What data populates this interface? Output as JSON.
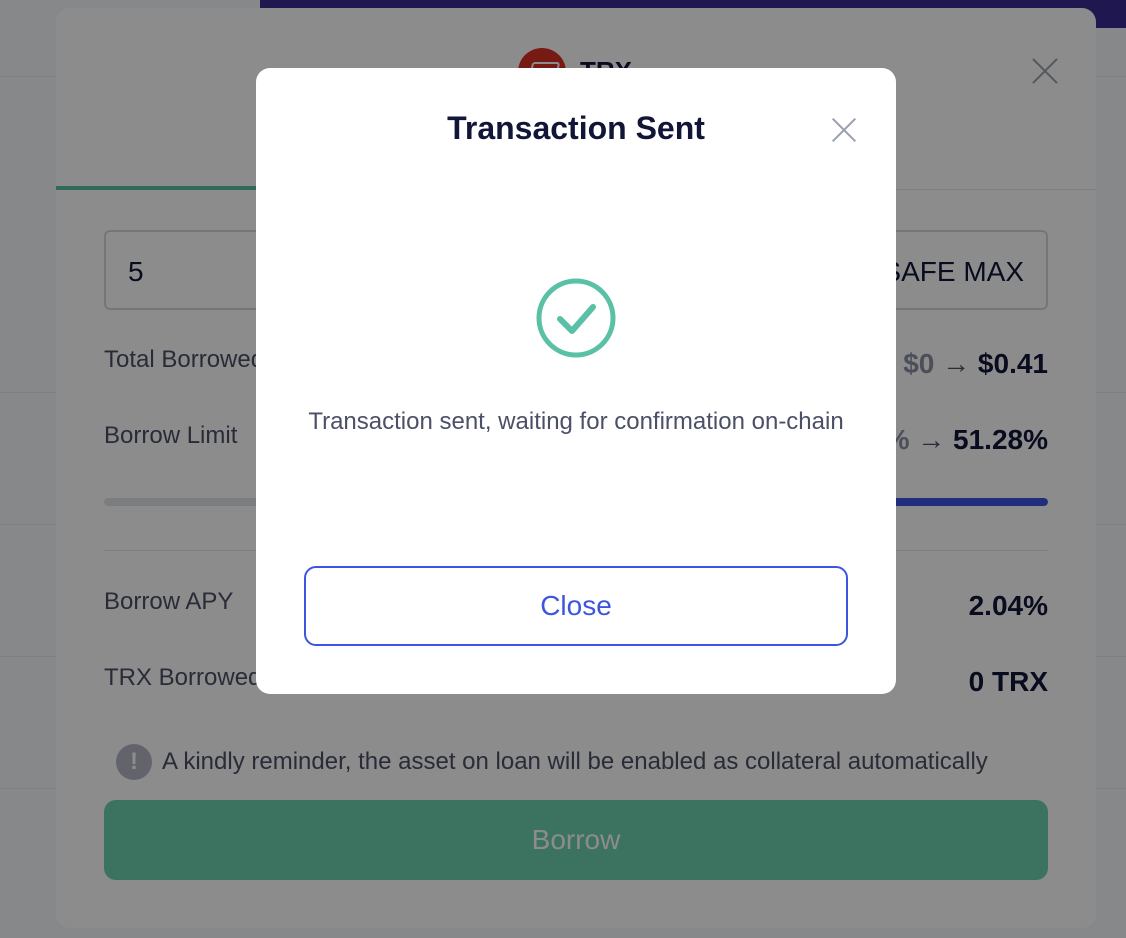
{
  "borrow_modal": {
    "asset_symbol": "TRX",
    "amount_value": "5",
    "safe_max_label": "SAFE MAX",
    "total_borrowed": {
      "label": "Total Borrowed",
      "from": "$0",
      "to": "$0.41"
    },
    "borrow_limit": {
      "label": "Borrow Limit",
      "from": "%",
      "to": "51.28%",
      "fill_fraction": 0.5128
    },
    "borrow_apy": {
      "label": "Borrow APY",
      "value": "2.04%"
    },
    "trx_borrowed": {
      "label": "TRX Borrowed",
      "value": "0 TRX"
    },
    "reminder_text": "A kindly reminder, the asset on loan will be enabled as collateral automatically",
    "borrow_button_label": "Borrow"
  },
  "tx_dialog": {
    "title": "Transaction Sent",
    "message": "Transaction sent, waiting for confirmation on-chain",
    "close_button_label": "Close",
    "success_color": "#5ac0a6"
  }
}
